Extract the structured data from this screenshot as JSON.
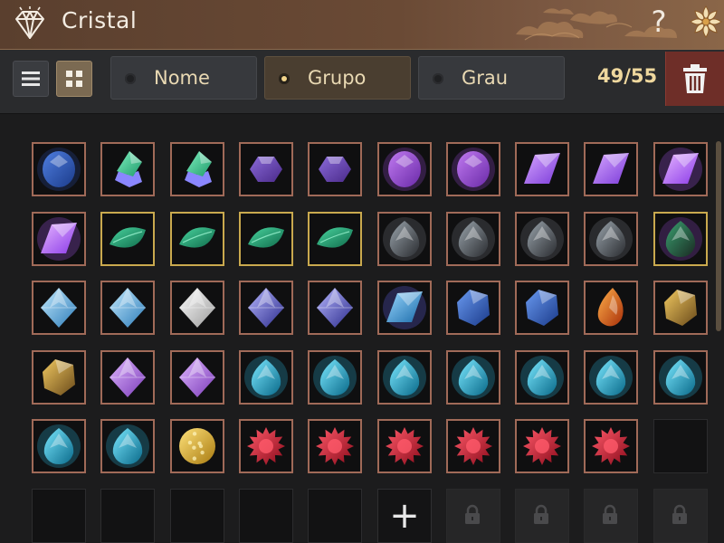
{
  "window": {
    "title": "Cristal"
  },
  "header": {
    "help_label": "?"
  },
  "sort": {
    "options": [
      {
        "label": "Nome",
        "selected": false
      },
      {
        "label": "Grupo",
        "selected": true
      },
      {
        "label": "Grau",
        "selected": false
      }
    ]
  },
  "inventory": {
    "capacity_text": "49/55",
    "used": 49,
    "total": 55,
    "add_label": "+",
    "items": [
      {
        "gem": "sapphire-dark",
        "rare": false
      },
      {
        "gem": "emerald-cluster",
        "rare": false
      },
      {
        "gem": "emerald-cluster",
        "rare": false
      },
      {
        "gem": "amethyst-hex",
        "rare": false
      },
      {
        "gem": "amethyst-hex",
        "rare": false
      },
      {
        "gem": "amethyst-oval",
        "rare": false
      },
      {
        "gem": "amethyst-oval",
        "rare": false
      },
      {
        "gem": "amethyst-shard",
        "rare": false
      },
      {
        "gem": "amethyst-shard",
        "rare": false
      },
      {
        "gem": "amethyst-shard-glow",
        "rare": false
      },
      {
        "gem": "amethyst-shard-glow",
        "rare": false
      },
      {
        "gem": "jade-leaf",
        "rare": true
      },
      {
        "gem": "jade-leaf",
        "rare": true
      },
      {
        "gem": "jade-leaf",
        "rare": true
      },
      {
        "gem": "jade-leaf",
        "rare": true
      },
      {
        "gem": "obsidian-drop",
        "rare": false
      },
      {
        "gem": "obsidian-drop",
        "rare": false
      },
      {
        "gem": "obsidian-drop",
        "rare": false
      },
      {
        "gem": "obsidian-drop",
        "rare": false
      },
      {
        "gem": "obsidian-emerald",
        "rare": true
      },
      {
        "gem": "diamond-octa-blue",
        "rare": false
      },
      {
        "gem": "diamond-octa-blue",
        "rare": false
      },
      {
        "gem": "diamond-silver",
        "rare": false
      },
      {
        "gem": "diamond-indigo",
        "rare": false
      },
      {
        "gem": "diamond-indigo",
        "rare": false
      },
      {
        "gem": "crystal-lightning",
        "rare": false
      },
      {
        "gem": "sapphire-rough",
        "rare": false
      },
      {
        "gem": "sapphire-rough",
        "rare": false
      },
      {
        "gem": "fire-opal",
        "rare": false
      },
      {
        "gem": "gold-crystal",
        "rare": false
      },
      {
        "gem": "gold-crystal",
        "rare": false
      },
      {
        "gem": "amethyst-block",
        "rare": false
      },
      {
        "gem": "amethyst-block",
        "rare": false
      },
      {
        "gem": "aquamarine-drop",
        "rare": false
      },
      {
        "gem": "aquamarine-drop",
        "rare": false
      },
      {
        "gem": "aquamarine-drop",
        "rare": false
      },
      {
        "gem": "aquamarine-drop",
        "rare": false
      },
      {
        "gem": "aquamarine-drop",
        "rare": false
      },
      {
        "gem": "aquamarine-drop",
        "rare": false
      },
      {
        "gem": "aquamarine-drop",
        "rare": false
      },
      {
        "gem": "aquamarine-drop",
        "rare": false
      },
      {
        "gem": "aquamarine-drop",
        "rare": false
      },
      {
        "gem": "gold-nugget",
        "rare": false
      },
      {
        "gem": "ruby-star",
        "rare": false
      },
      {
        "gem": "ruby-star",
        "rare": false
      },
      {
        "gem": "ruby-star",
        "rare": false
      },
      {
        "gem": "ruby-star",
        "rare": false
      },
      {
        "gem": "ruby-star",
        "rare": false
      },
      {
        "gem": "ruby-star",
        "rare": false
      }
    ]
  },
  "colors": {
    "title_bar": "#6a4a35",
    "active_sort": "#4a3e30",
    "capacity_text": "#efd89e",
    "delete_button": "#6e2e28",
    "item_border": "#a06a58",
    "rare_border": "#c9a94e"
  },
  "icons": {
    "title": "crystal-diamond-icon",
    "help": "help-icon",
    "settings": "lotus-flower-icon",
    "list_view": "list-view-icon",
    "grid_view": "grid-view-icon",
    "delete": "trash-icon",
    "add": "plus-icon",
    "locked": "lock-icon"
  }
}
